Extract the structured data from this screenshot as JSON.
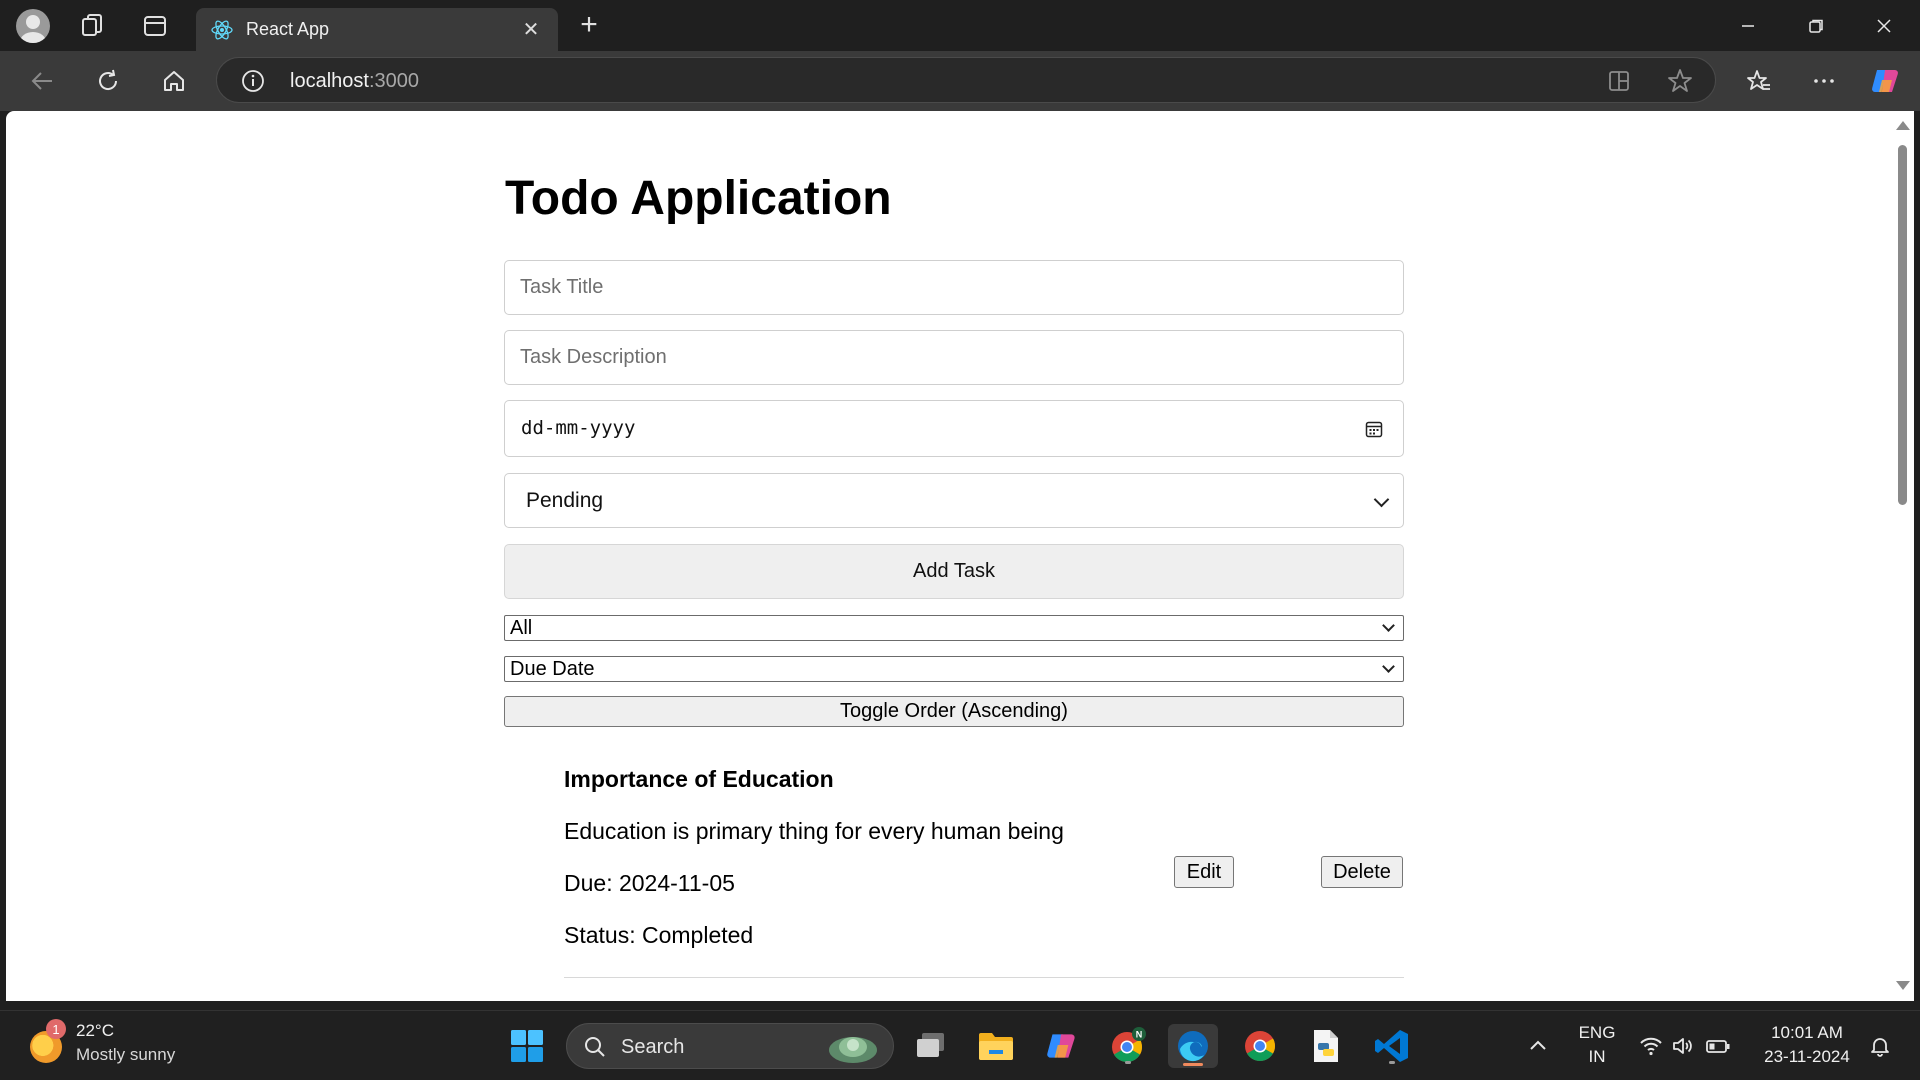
{
  "browser": {
    "tab_title": "React App",
    "url_host": "localhost",
    "url_port": ":3000"
  },
  "page": {
    "heading": "Todo Application",
    "form": {
      "title_placeholder": "Task Title",
      "description_placeholder": "Task Description",
      "date_placeholder": "dd-mm-yyyy",
      "status_selected": "Pending",
      "add_label": "Add Task"
    },
    "filters": {
      "status_filter": "All",
      "sort_by": "Due Date",
      "toggle_label": "Toggle Order (Ascending)"
    },
    "tasks": [
      {
        "title": "Importance of Education",
        "description": "Education is primary thing for every human being",
        "due": "Due: 2024-11-05",
        "status": "Status: Completed",
        "edit_label": "Edit",
        "delete_label": "Delete"
      }
    ]
  },
  "taskbar": {
    "weather_badge": "1",
    "temperature": "22°C",
    "weather_desc": "Mostly sunny",
    "search_label": "Search",
    "language": "ENG",
    "region": "IN",
    "time": "10:01 AM",
    "date": "23-11-2024"
  },
  "colors": {
    "accent_edge": "#0f6cbd",
    "vscode_blue": "#0078d4",
    "chrome_red": "#db4437"
  }
}
